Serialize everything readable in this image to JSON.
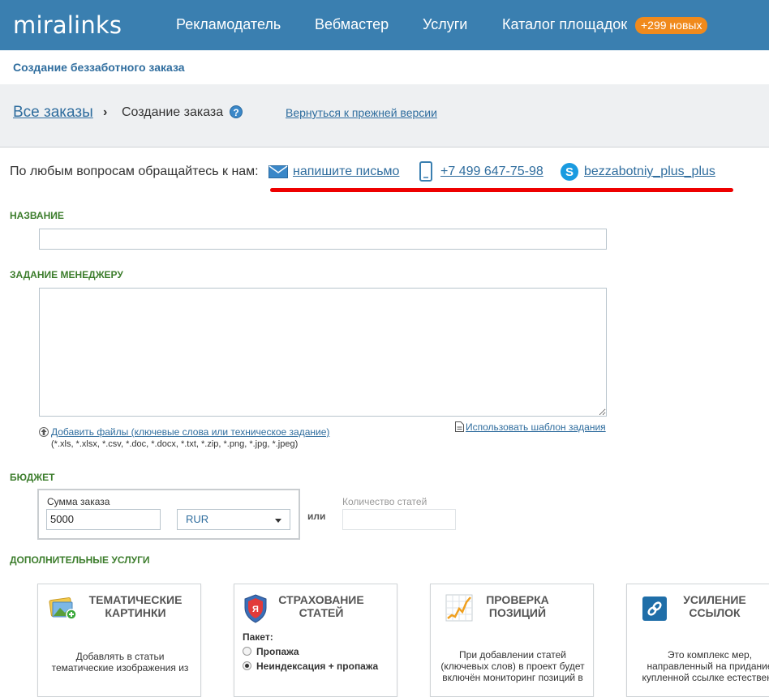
{
  "header": {
    "logo": "miralinks",
    "nav": [
      "Рекламодатель",
      "Вебмастер",
      "Услуги",
      "Каталог площадок"
    ],
    "badge": "+299 новых"
  },
  "subheader": {
    "title": "Создание беззаботного заказа"
  },
  "breadcrumb": {
    "all_orders": "Все заказы",
    "separator": "›",
    "current": "Создание заказа",
    "help": "?",
    "back_link": "Вернуться к прежней версии"
  },
  "contact": {
    "label": "По любым вопросам обращайтесь к нам:",
    "email_link": "напишите письмо",
    "phone": "+7 499 647-75-98",
    "skype": "bezzabotniy_plus_plus"
  },
  "form": {
    "name_title": "НАЗВАНИЕ",
    "name_value": "",
    "task_title": "ЗАДАНИЕ МЕНЕДЖЕРУ",
    "task_value": "",
    "add_files": "Добавить файлы (ключевые слова или техническое задание)",
    "file_types": "(*.xls, *.xlsx, *.csv, *.doc, *.docx, *.txt, *.zip, *.png, *.jpg, *.jpeg)",
    "use_template": "Использовать шаблон задания"
  },
  "budget": {
    "title": "БЮДЖЕТ",
    "sum_label": "Сумма заказа",
    "sum_value": "5000",
    "currency": "RUR",
    "or": "или",
    "qty_label": "Количество статей",
    "qty_value": ""
  },
  "services": {
    "title": "ДОПОЛНИТЕЛЬНЫЕ УСЛУГИ",
    "cards": [
      {
        "title": "ТЕМАТИЧЕСКИЕ\nКАРТИНКИ",
        "desc": "Добавлять в статьи\nтематические изображения из"
      },
      {
        "title": "СТРАХОВАНИЕ\nСТАТЕЙ",
        "package_label": "Пакет:",
        "options": [
          "Пропажа",
          "Неиндексация + пропажа"
        ],
        "selected": 1
      },
      {
        "title": "ПРОВЕРКА\nПОЗИЦИЙ",
        "desc": "При добавлении статей\n(ключевых слов) в проект будет\nвключён мониторинг позиций в"
      },
      {
        "title": "УСИЛЕНИЕ\nССЫЛОК",
        "desc": "Это комплекс мер,\nнаправленный на придание\nкупленной ссылке естественн"
      }
    ]
  },
  "colors": {
    "nav_bg": "#3a7fb0",
    "badge_bg": "#f08a1c",
    "section_green": "#3c7d2c",
    "link_blue": "#2f6d9e",
    "highlight_red": "#ee0000"
  }
}
